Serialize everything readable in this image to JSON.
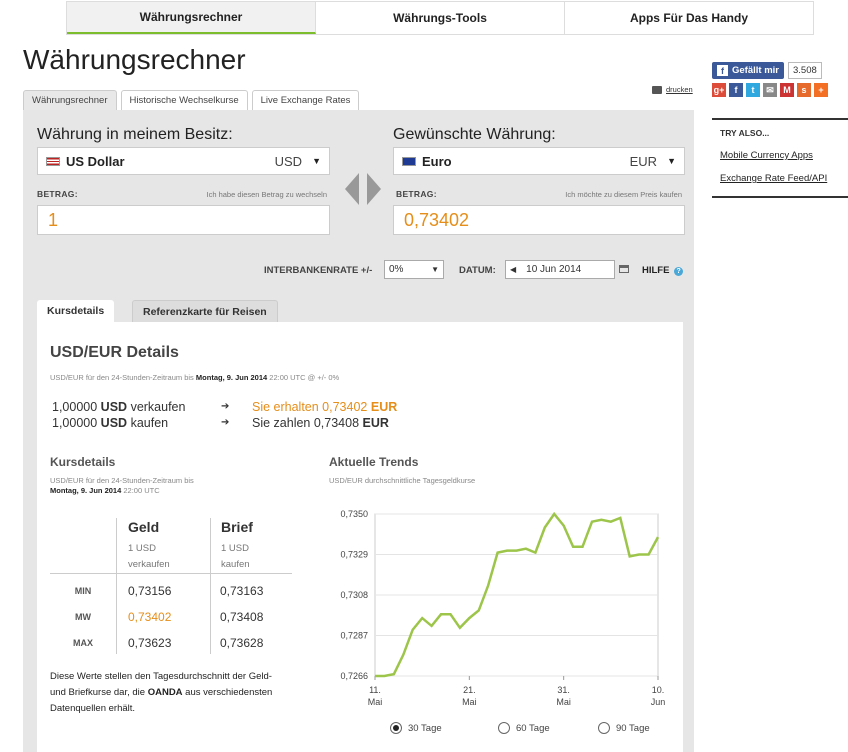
{
  "topnav": {
    "items": [
      "Währungsrechner",
      "Währungs-Tools",
      "Apps Für Das Handy"
    ]
  },
  "title": "Währungsrechner",
  "subtabs": [
    "Währungsrechner",
    "Historische Wechselkurse",
    "Live Exchange Rates"
  ],
  "print_label": "drucken",
  "from": {
    "label": "Währung in meinem Besitz:",
    "currency": "US Dollar",
    "code": "USD",
    "amount_label": "BETRAG:",
    "amount_hint": "Ich habe diesen Betrag zu wechseln",
    "amount": "1"
  },
  "to": {
    "label": "Gewünschte Währung:",
    "currency": "Euro",
    "code": "EUR",
    "amount_label": "BETRAG:",
    "amount_hint": "Ich möchte zu diesem Preis kaufen",
    "amount": "0,73402"
  },
  "controls": {
    "rate_label": "INTERBANKENRATE +/-",
    "rate_value": "0%",
    "date_label": "DATUM:",
    "date_value": "10 Jun 2014",
    "help": "HILFE"
  },
  "inner_tabs": [
    "Kursdetails",
    "Referenzkarte für Reisen"
  ],
  "details": {
    "heading": "USD/EUR Details",
    "period_prefix": "USD/EUR für den 24-Stunden-Zeitraum bis",
    "period_date": "Montag, 9. Jun 2014",
    "period_suffix": "22:00 UTC @ +/- 0%",
    "row1": {
      "amt": "1,00000",
      "cur": "USD",
      "verb": "verkaufen",
      "result": "Sie erhalten 0,73402",
      "rcur": "EUR"
    },
    "row2": {
      "amt": "1,00000",
      "cur": "USD",
      "verb": "kaufen",
      "result": "Sie zahlen 0,73408",
      "rcur": "EUR"
    }
  },
  "kurs": {
    "heading": "Kursdetails",
    "sub1": "USD/EUR für den 24-Stunden-Zeitraum bis",
    "sub_date": "Montag, 9. Jun 2014",
    "sub_time": "22:00 UTC",
    "col_geld": "Geld",
    "col_brief": "Brief",
    "geld_sub1": "1 USD",
    "geld_sub2": "verkaufen",
    "brief_sub1": "1 USD",
    "brief_sub2": "kaufen",
    "rows": [
      {
        "label": "MIN",
        "geld": "0,73156",
        "brief": "0,73163"
      },
      {
        "label": "MW",
        "geld": "0,73402",
        "brief": "0,73408"
      },
      {
        "label": "MAX",
        "geld": "0,73623",
        "brief": "0,73628"
      }
    ],
    "note_a": "Diese Werte stellen den Tagesdurchschnitt der Geld- und Briefkurse dar, die ",
    "note_b": "OANDA",
    "note_c": " aus verschiedensten Datenquellen erhält."
  },
  "trends": {
    "heading": "Aktuelle Trends",
    "sub": "USD/EUR durchschnittliche Tagesgeldkurse",
    "radios": [
      "30 Tage",
      "60 Tage",
      "90 Tage"
    ]
  },
  "social": {
    "like": "Gefällt mir",
    "count": "3.508"
  },
  "tryalso": {
    "heading": "TRY ALSO...",
    "links": [
      "Mobile Currency Apps",
      "Exchange Rate Feed/API"
    ]
  },
  "colors": {
    "accent": "#7cbd2d",
    "orange": "#e58e1a",
    "line": "#9cc54a"
  },
  "chart_data": {
    "type": "line",
    "title": "",
    "ylim": [
      0.7266,
      0.735
    ],
    "yticks": [
      "0,7350",
      "0,7329",
      "0,7308",
      "0,7287",
      "0,7266"
    ],
    "xticks": [
      {
        "d1": "11.",
        "d2": "Mai"
      },
      {
        "d1": "21.",
        "d2": "Mai"
      },
      {
        "d1": "31.",
        "d2": "Mai"
      },
      {
        "d1": "10.",
        "d2": "Jun"
      }
    ],
    "x_start": 11,
    "x_end": 41,
    "series": [
      {
        "values": [
          0.7266,
          0.7266,
          0.7267,
          0.7277,
          0.729,
          0.7296,
          0.7292,
          0.7298,
          0.7298,
          0.7291,
          0.7296,
          0.73,
          0.7313,
          0.733,
          0.7331,
          0.7331,
          0.7332,
          0.733,
          0.7343,
          0.735,
          0.7344,
          0.7333,
          0.7333,
          0.7346,
          0.7347,
          0.7346,
          0.7348,
          0.7328,
          0.7329,
          0.7329,
          0.7338
        ]
      }
    ]
  }
}
